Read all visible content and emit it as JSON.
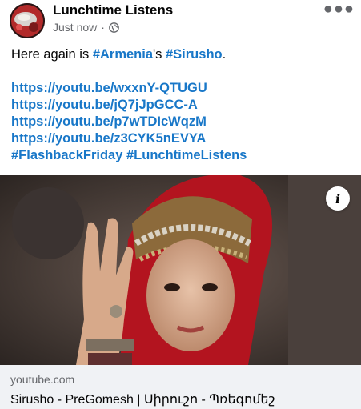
{
  "post": {
    "page_name": "Lunchtime Listens",
    "timestamp": "Just now",
    "separator": "·",
    "privacy_icon": "globe-icon",
    "more_icon": "more-options-icon",
    "text": {
      "prefix": "Here again is ",
      "tag_armenia": "#Armenia",
      "possessive": "'s ",
      "tag_sirusho": "#Sirusho",
      "period": ".",
      "links": [
        "https://youtu.be/wxxnY-QTUGU",
        "https://youtu.be/jQ7jJpGCC-A",
        "https://youtu.be/p7wTDIcWqzM",
        "https://youtu.be/z3CYK5nEVYA"
      ],
      "tag_flashback": "#FlashbackFriday",
      "tag_lunchtime": "#LunchtimeListens"
    }
  },
  "link_preview": {
    "domain": "youtube.com",
    "title": "Sirusho - PreGomesh | Սիրուշո - Պռեգոմեշ",
    "info_label": "i"
  },
  "colors": {
    "link": "#1877c8",
    "preview_bg": "#f0f2f5",
    "secondary_text": "#65676b"
  }
}
